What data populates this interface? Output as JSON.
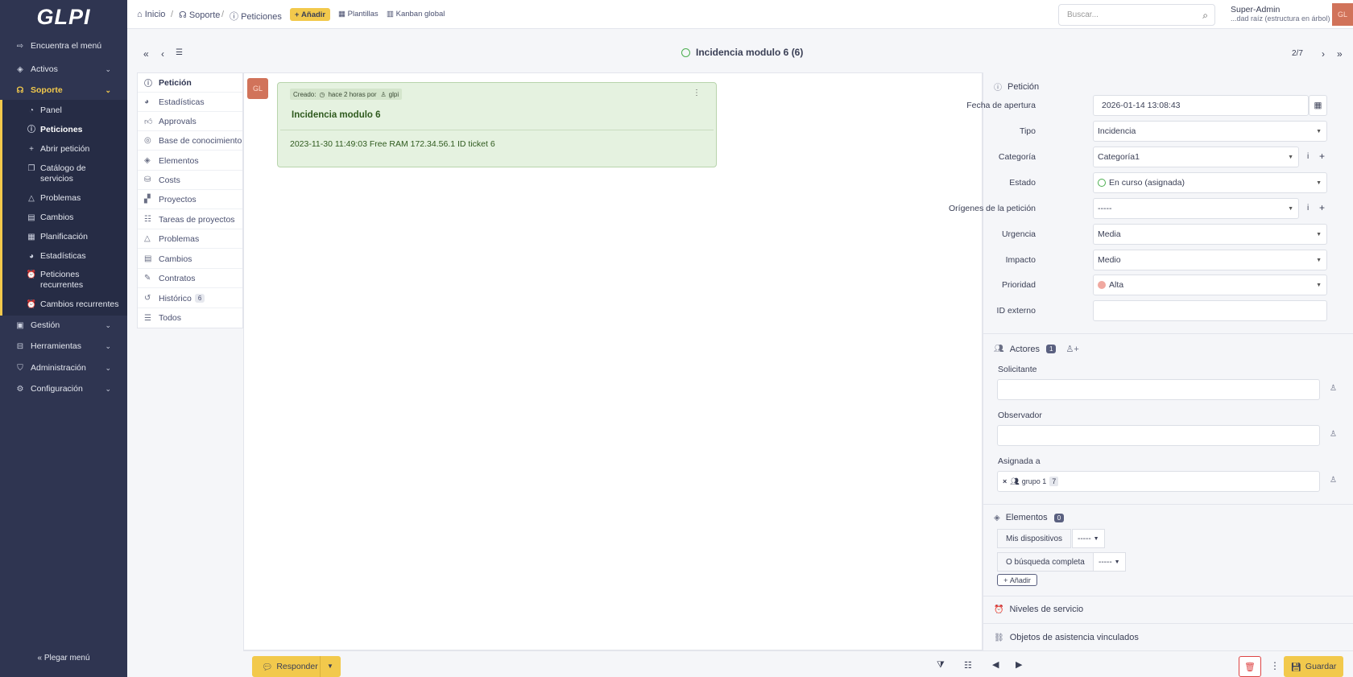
{
  "logo": "GLPI",
  "sidebar": {
    "find_menu": "Encuentra el menú",
    "items": [
      {
        "label": "Activos"
      },
      {
        "label": "Soporte"
      },
      {
        "label": "Gestión"
      },
      {
        "label": "Herramientas"
      },
      {
        "label": "Administración"
      },
      {
        "label": "Configuración"
      }
    ],
    "support_sub": [
      {
        "label": "Panel"
      },
      {
        "label": "Peticiones"
      },
      {
        "label": "Abrir petición"
      },
      {
        "label": "Catálogo de servicios"
      },
      {
        "label": "Problemas"
      },
      {
        "label": "Cambios"
      },
      {
        "label": "Planificación"
      },
      {
        "label": "Estadísticas"
      },
      {
        "label": "Peticiones recurrentes"
      },
      {
        "label": "Cambios recurrentes"
      }
    ],
    "collapse": "Plegar menú"
  },
  "topbar": {
    "breadcrumb": [
      "Inicio",
      "Soporte",
      "Peticiones"
    ],
    "add": "Añadir",
    "templates": "Plantillas",
    "kanban": "Kanban global",
    "search_placeholder": "Buscar...",
    "user_name": "Super-Admin",
    "user_entity": "...dad raíz (estructura en árbol)",
    "avatar": "GL"
  },
  "ticket": {
    "title": "Incidencia modulo 6 (6)",
    "pager": "2/7"
  },
  "tabs": [
    {
      "label": "Petición"
    },
    {
      "label": "Estadísticas"
    },
    {
      "label": "Approvals"
    },
    {
      "label": "Base de conocimiento"
    },
    {
      "label": "Elementos"
    },
    {
      "label": "Costs"
    },
    {
      "label": "Proyectos"
    },
    {
      "label": "Tareas de proyectos"
    },
    {
      "label": "Problemas"
    },
    {
      "label": "Cambios"
    },
    {
      "label": "Contratos"
    },
    {
      "label": "Histórico",
      "badge": "6"
    },
    {
      "label": "Todos"
    }
  ],
  "timeline": {
    "avatar": "GL",
    "created_label": "Creado:",
    "created_when": "hace 2 horas por",
    "created_by": "glpi",
    "title": "Incidencia modulo 6",
    "body": "2023-11-30 11:49:03 Free RAM 172.34.56.1 ID ticket 6"
  },
  "form": {
    "section": "Petición",
    "fields": [
      {
        "label": "Fecha de apertura",
        "value": "2026-01-14 13:08:43"
      },
      {
        "label": "Tipo",
        "value": "Incidencia"
      },
      {
        "label": "Categoría",
        "value": "Categoría1"
      },
      {
        "label": "Estado",
        "value": "En curso (asignada)"
      },
      {
        "label": "Orígenes de la petición",
        "value": "-----"
      },
      {
        "label": "Urgencia",
        "value": "Media"
      },
      {
        "label": "Impacto",
        "value": "Medio"
      },
      {
        "label": "Prioridad",
        "value": "Alta"
      },
      {
        "label": "ID externo",
        "value": ""
      }
    ]
  },
  "actors": {
    "title": "Actores",
    "count": "1",
    "requester": "Solicitante",
    "observer": "Observador",
    "assigned": "Asignada a",
    "assigned_group": "grupo 1",
    "assigned_group_count": "7"
  },
  "elements": {
    "title": "Elementos",
    "count": "0",
    "my_devices": "Mis dispositivos",
    "my_devices_value": "-----",
    "full_search": "O búsqueda completa",
    "full_search_value": "-----",
    "add": "Añadir"
  },
  "service_levels": "Niveles de servicio",
  "linked_items": "Objetos de asistencia vinculados",
  "bottom": {
    "reply": "Responder",
    "save": "Guardar"
  },
  "colors": {
    "sidebar": "#2f3551",
    "accent": "#f2c94c",
    "bubble": "#e5f2e0",
    "status_green": "#4caf50",
    "priority": "#f0a8a0"
  }
}
